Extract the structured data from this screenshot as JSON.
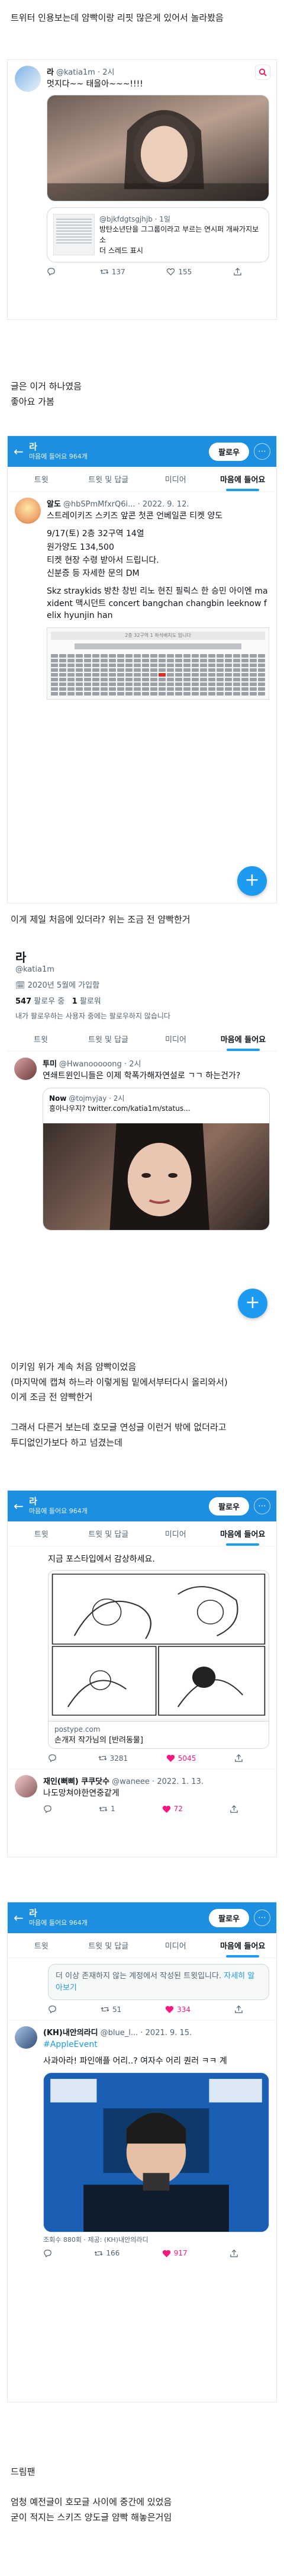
{
  "intro": "트위터 인용보는데 얌빡이랑 리핏 많은게 있어서 놀라봤음",
  "tweet1": {
    "name": "라",
    "handle": "@katia1m · 2시",
    "text": "멋지다~~ 태을아~~~!!!!",
    "quote_handle": "@bjkfdgtsgjhjb · 1일",
    "quote_text": "방탄소년단을 그그룹이라고 부르는 연시퍼 개싸가지보소",
    "quote_link": "더 스레드 표시",
    "replies": "",
    "retweets": "137",
    "likes": "155"
  },
  "text2": [
    "글은 이거 하나였음",
    "좋아요 가봄"
  ],
  "profileA": {
    "title": "라",
    "subtitle": "마음에 들어요 964개",
    "follow": "팔로우",
    "tabs": [
      "트윗",
      "트윗 및 답글",
      "미디어",
      "마음에 들어요"
    ],
    "active_tab": 3
  },
  "tweet2": {
    "name": "알도",
    "handle": "@hbSPmMfxrQ6i... · 2022. 9. 12.",
    "lines": [
      "스트레이키즈 스키즈 앞콘 첫콘 언베일콘 티켓 양도",
      "9/17(토) 2층 32구역 14열",
      "원가양도 134,500",
      "티켓 현장 수령 받아서 드립니다.",
      "신분증 등 자세한 문의 DM",
      "Skz straykids 방찬 창빈 리노 현진 필릭스 한 승민 아이엔 maxident 맥시던트 concert bangchan changbin leeknow felix hyunjin han"
    ],
    "seat_label": "2층 32구역 1 좌석배치도 입니다"
  },
  "text3": "이게 제일 처음에 있더라? 위는 조금 전 얌빡한거",
  "profileB": {
    "name": "라",
    "handle": "@katia1m",
    "joined": "2020년 5월에 가입함",
    "following_count": "547",
    "following_label": "팔로우 중",
    "followers_count": "1",
    "followers_label": "팔로워",
    "note": "내가 팔로우하는 사용자 중에는 팔로우하지 않습니다",
    "tabs": [
      "트윗",
      "트윗 및 답글",
      "미디어",
      "마음에 들어요"
    ],
    "active_tab": 3
  },
  "tweet3": {
    "name": "투미",
    "handle": "@Hwanooooong · 2시",
    "text": "연쇄트윈인니들은 이제 학폭가해자연설로 ㄱㄱ 하는건가?",
    "quote_name": "Now",
    "quote_handle": "@tojmyjay · 2시",
    "quote_text": "흥아나우지? twitter.com/katia1m/status..."
  },
  "text4": [
    "이키임 위가 계속 처음 얌빡이었음",
    "(마지막에 캡쳐 하느라 이렇게됨 밑에서부터다시 올리와서)",
    "이게 조금 전 얌빡한거",
    "",
    "그래서 다른거 보는데 호모글 연성글 이런거 밖에 없더라고",
    "투디없인가보다 하고 넘겼는데"
  ],
  "profileC": {
    "title": "라",
    "subtitle": "마음에 들어요 964개",
    "follow": "팔로우",
    "tabs": [
      "트윗",
      "트윗 및 답글",
      "미디어",
      "마음에 들어요"
    ],
    "active_tab": 3
  },
  "tweet4": {
    "text": "지금 포스타입에서 감상하세요.",
    "card_domain": "postype.com",
    "card_title": "손개저 작가님의 [반려동물]",
    "replies": "",
    "retweets": "3281",
    "likes": "5045"
  },
  "tweet5": {
    "name": "재인(뻐삐) 쿠쿠닷수",
    "handle": "@waneee · 2022. 1. 13.",
    "text": "나도망쳐야한연중같게",
    "retweets": "1",
    "likes": "72"
  },
  "profileD": {
    "title": "라",
    "subtitle": "마음에 들어요 964개",
    "follow": "팔로우",
    "tabs": [
      "트윗",
      "트윗 및 답글",
      "미디어",
      "마음에 들어요"
    ],
    "active_tab": 3
  },
  "tweet6": {
    "notice": "더 이상 존재하지 않는 계정에서 작성된 트윗입니다.",
    "notice_link": "자세히 알아보기",
    "retweets": "51",
    "likes": "334"
  },
  "tweet7": {
    "name": "(KH)내안의라디",
    "handle": "@blue_l... · 2021. 9. 15.",
    "hashtag": "#AppleEvent",
    "text": "사과아라! 파인애플 어리..? 여자수 어리 퀀러 ㅋㅋ 계",
    "caption": "조회수 880회 · 제공: (KH)내안의라디",
    "retweets": "166",
    "likes": "917"
  },
  "outro": [
    "드림팬",
    "",
    "엄청 예전글이 호모글 사이에 중간에 있었음",
    "굳이 적지는 스키즈 양도글 얌빡 해놓은거임"
  ]
}
